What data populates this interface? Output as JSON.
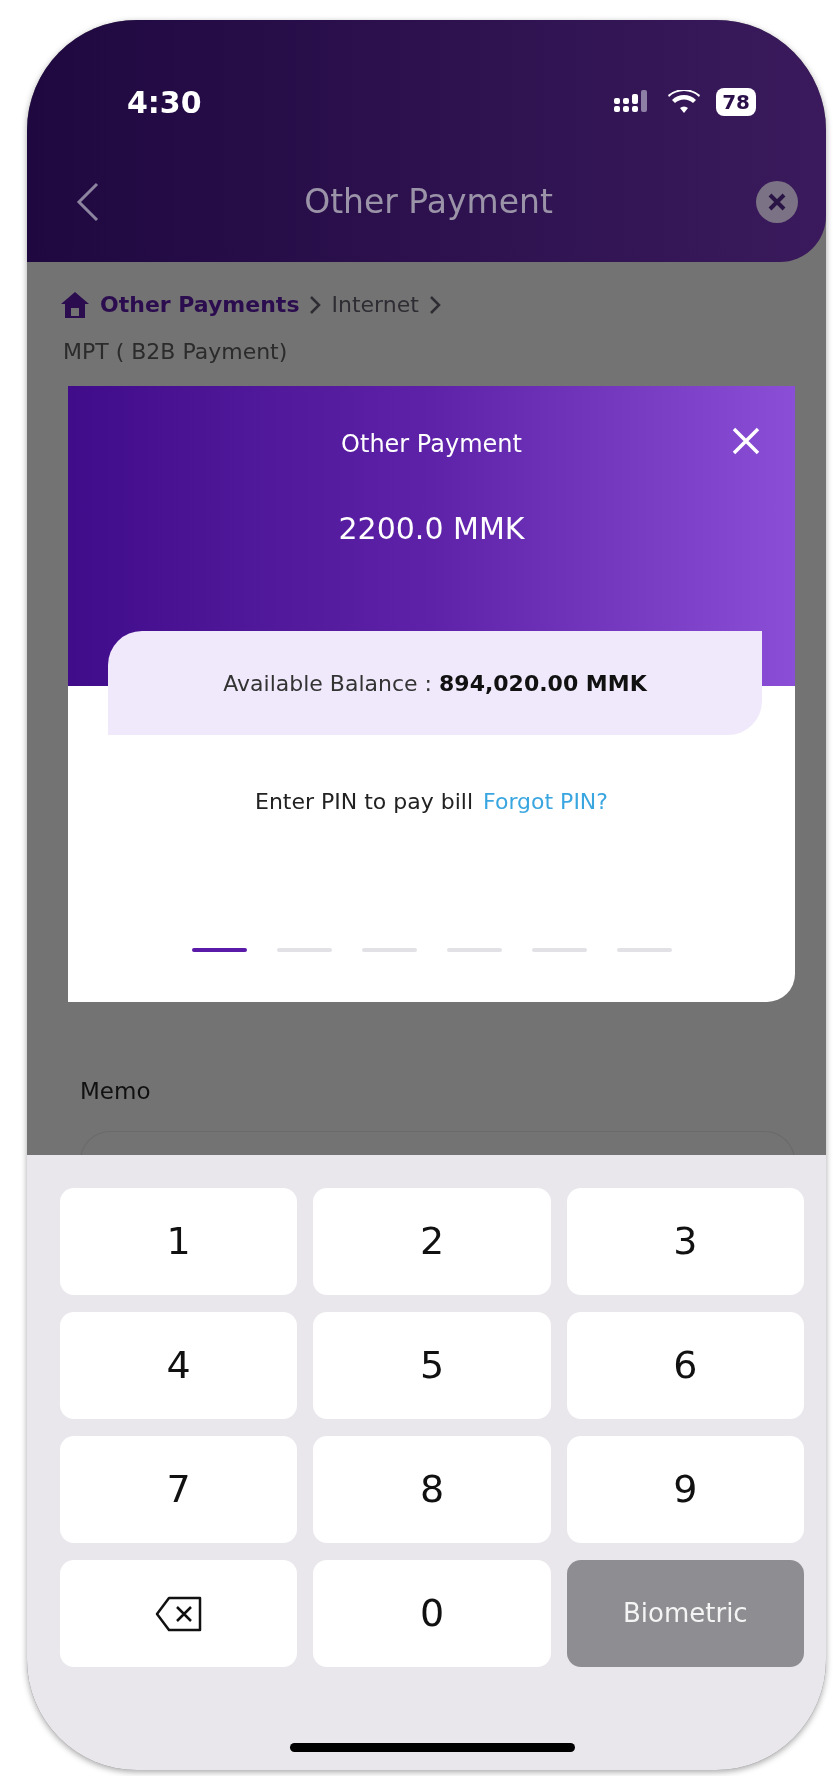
{
  "status_bar": {
    "time": "4:30",
    "battery": "78"
  },
  "header": {
    "title": "Other Payment"
  },
  "breadcrumb": {
    "items": [
      "Other Payments",
      "Internet"
    ]
  },
  "subtitle": "MPT ( B2B Payment)",
  "pin_modal": {
    "title": "Other Payment",
    "amount": "2200.0 MMK",
    "balance": "Available Balance : **894,020.00 MMK**",
    "prompt": "Enter PIN to pay bill",
    "forgot_link": "Forgot PIN?",
    "pin_slots": [
      {
        "selected": true
      },
      {
        "selected": false
      },
      {
        "selected": false
      },
      {
        "selected": false
      },
      {
        "selected": false
      },
      {
        "selected": false
      }
    ]
  },
  "memo": {
    "label": "Memo"
  },
  "keypad": [
    {
      "kind": "digit",
      "label": "1"
    },
    {
      "kind": "digit",
      "label": "2"
    },
    {
      "kind": "digit",
      "label": "3"
    },
    {
      "kind": "digit",
      "label": "4"
    },
    {
      "kind": "digit",
      "label": "5"
    },
    {
      "kind": "digit",
      "label": "6"
    },
    {
      "kind": "digit",
      "label": "7"
    },
    {
      "kind": "digit",
      "label": "8"
    },
    {
      "kind": "digit",
      "label": "9"
    },
    {
      "kind": "backspace"
    },
    {
      "kind": "digit",
      "label": "0"
    },
    {
      "kind": "biometric",
      "label": "Biometric"
    }
  ]
}
